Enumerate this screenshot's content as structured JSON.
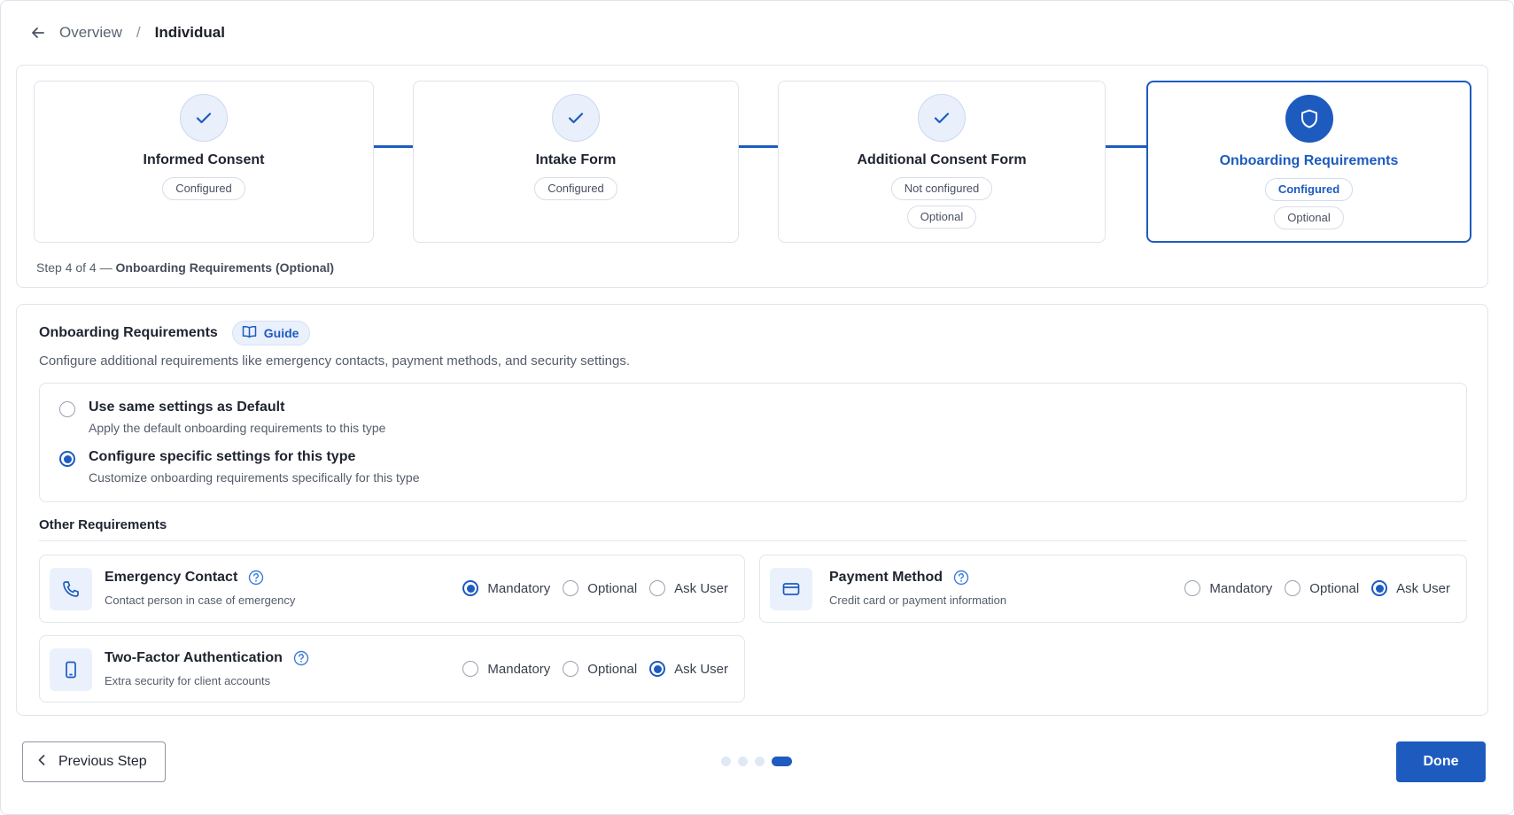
{
  "colors": {
    "accent": "#1d5bbf",
    "accent_light": "#eaf1fc",
    "border": "#e1e5ec"
  },
  "breadcrumb": {
    "back_icon": "arrow-left-icon",
    "parent": "Overview",
    "separator": "/",
    "current": "Individual"
  },
  "stepper": {
    "steps": [
      {
        "title": "Informed Consent",
        "status": "Configured",
        "icon": "check-icon"
      },
      {
        "title": "Intake Form",
        "status": "Configured",
        "icon": "check-icon"
      },
      {
        "title": "Additional Consent Form",
        "status": "Not configured",
        "optional": "Optional",
        "icon": "check-icon"
      },
      {
        "title": "Onboarding Requirements",
        "status": "Configured",
        "optional": "Optional",
        "icon": "shield-icon"
      }
    ],
    "caption_prefix": "Step 4 of 4 —",
    "caption_bold": "Onboarding Requirements (Optional)"
  },
  "section": {
    "title": "Onboarding Requirements",
    "guide_label": "Guide",
    "description": "Configure additional requirements like emergency contacts, payment methods, and security settings."
  },
  "settings": {
    "options": [
      {
        "title": "Use same settings as Default",
        "subtitle": "Apply the default onboarding requirements to this type",
        "selected": false
      },
      {
        "title": "Configure specific settings for this type",
        "subtitle": "Customize onboarding requirements specifically for this type",
        "selected": true
      }
    ]
  },
  "other": {
    "title": "Other Requirements",
    "choice_labels": [
      "Mandatory",
      "Optional",
      "Ask User"
    ],
    "items": [
      {
        "title": "Emergency Contact",
        "subtitle": "Contact person in case of emergency",
        "icon": "phone-icon",
        "selected": "Mandatory"
      },
      {
        "title": "Payment Method",
        "subtitle": "Credit card or payment information",
        "icon": "credit-card-icon",
        "selected": "Ask User"
      },
      {
        "title": "Two-Factor Authentication",
        "subtitle": "Extra security for client accounts",
        "icon": "smartphone-icon",
        "selected": "Ask User"
      }
    ]
  },
  "footer": {
    "previous_label": "Previous Step",
    "done_label": "Done",
    "dots_total": 4,
    "dots_active_index": 3
  }
}
